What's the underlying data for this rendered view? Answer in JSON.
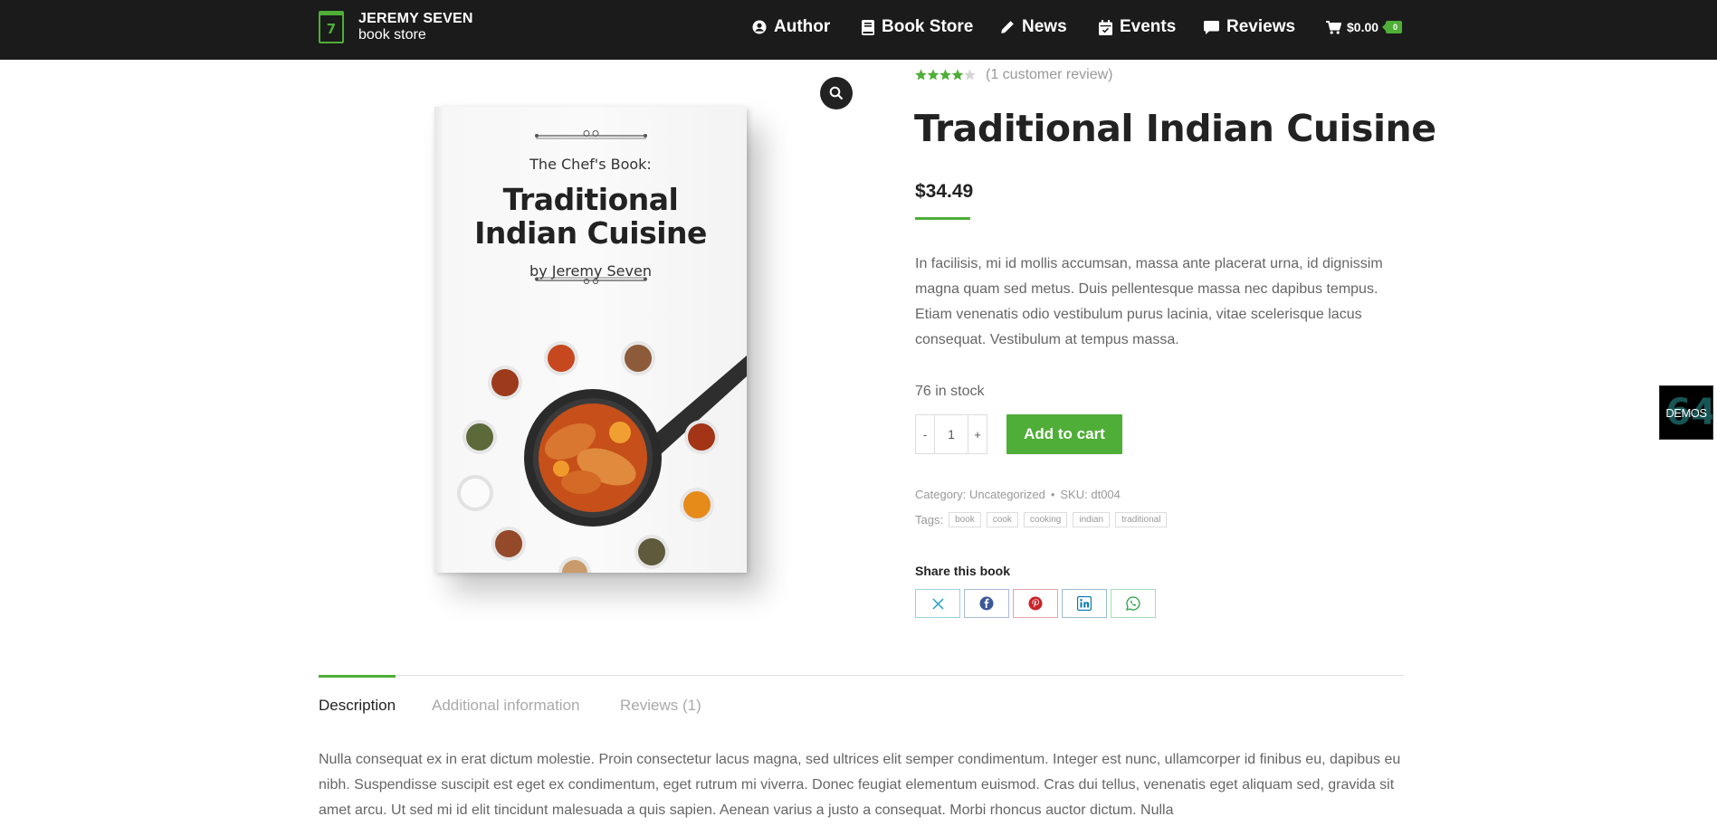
{
  "header": {
    "logo_digit": "7",
    "logo_name": "JEREMY SEVEN",
    "logo_sub": "book store",
    "nav": [
      {
        "label": "Author",
        "icon": "user-circle-icon"
      },
      {
        "label": "Book Store",
        "icon": "book-icon"
      },
      {
        "label": "News",
        "icon": "pencil-icon"
      },
      {
        "label": "Events",
        "icon": "calendar-icon"
      },
      {
        "label": "Reviews",
        "icon": "comment-icon"
      }
    ],
    "cart_total": "$0.00",
    "cart_count": "0"
  },
  "book_cover": {
    "pre": "The Chef's Book:",
    "title_line1": "Traditional",
    "title_line2": "Indian Cuisine",
    "by": "by Jeremy Seven"
  },
  "product": {
    "rating_stars": 4,
    "rating_max": 5,
    "rating_count": "(1 customer review)",
    "title": "Traditional Indian Cuisine",
    "price": "$34.49",
    "short_description": "In facilisis, mi id mollis accumsan, massa ante placerat urna, id dignissim magna quam sed metus. Duis pellentesque massa nec dapibus tempus. Etiam venenatis odio vestibulum purus lacinia, vitae scelerisque lacus consequat. Vestibulum at tempus massa.",
    "stock": "76 in stock",
    "qty_minus": "-",
    "qty_value": "1",
    "qty_plus": "+",
    "add_to_cart": "Add to cart",
    "category_label": "Category:",
    "category": "Uncategorized",
    "sku_label": "SKU:",
    "sku": "dt004",
    "tags_label": "Tags:",
    "tags": [
      "book",
      "cook",
      "cooking",
      "indian",
      "traditional"
    ],
    "share_title": "Share this book",
    "share": [
      "x-icon",
      "facebook-icon",
      "pinterest-icon",
      "linkedin-icon",
      "whatsapp-icon"
    ]
  },
  "tabs": [
    {
      "label": "Description",
      "active": true
    },
    {
      "label": "Additional information",
      "active": false
    },
    {
      "label": "Reviews (1)",
      "active": false
    }
  ],
  "long_description": "Nulla consequat ex in erat dictum molestie. Proin consectetur lacus magna, sed ultrices elit semper condimentum. Integer est nunc, ullamcorper id finibus eu, dapibus eu nibh. Suspendisse suscipit est eget ex condimentum, eget rutrum mi viverra. Donec feugiat elementum euismod. Cras dui tellus, venenatis eget aliquam sed, gravida sit amet arcu. Ut sed mi id elit tincidunt malesuada a quis sapien. Aenean varius a justo a consequat. Morbi rhoncus auctor dictum. Nulla",
  "demos": {
    "label": "DEMOS",
    "bg_text": "64"
  },
  "colors": {
    "accent": "#4fae37",
    "header_bg": "#1b1b1b"
  }
}
